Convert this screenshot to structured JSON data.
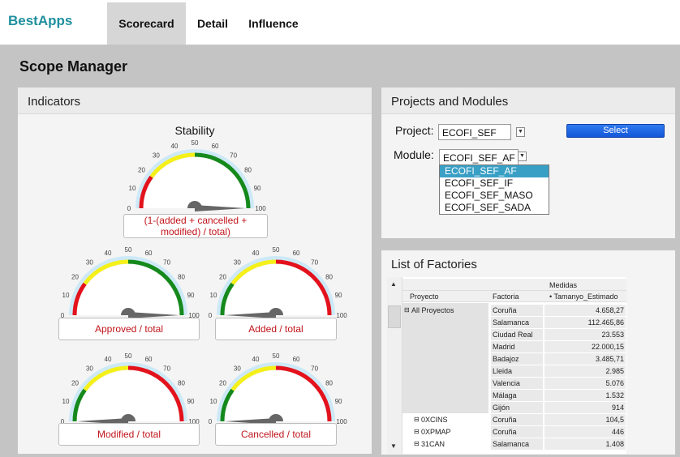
{
  "app": {
    "brand": "BestApps",
    "tabs": [
      {
        "label": "Scorecard"
      },
      {
        "label": "Detail"
      },
      {
        "label": "Influence"
      }
    ],
    "page_title": "Scope Manager"
  },
  "indicators": {
    "title": "Indicators",
    "gauges": [
      {
        "title": "Stability",
        "label": "(1-(added + cancelled + modified) / total)",
        "value": 100,
        "zones": "red-yellow-green"
      },
      {
        "title": "",
        "label": "Approved / total",
        "value": 100,
        "zones": "red-yellow-green"
      },
      {
        "title": "",
        "label": "Added / total",
        "value": 0,
        "zones": "green-yellow-red"
      },
      {
        "title": "",
        "label": "Modified / total",
        "value": 0,
        "zones": "green-yellow-red"
      },
      {
        "title": "",
        "label": "Cancelled / total",
        "value": 0,
        "zones": "green-yellow-red"
      }
    ],
    "ticks": [
      "0",
      "10",
      "20",
      "30",
      "40",
      "50",
      "60",
      "70",
      "80",
      "90",
      "100"
    ],
    "colors": {
      "red": "#e3121c",
      "yellow": "#f5f019",
      "green": "#15891c",
      "halo": "#cde9f7",
      "needle": "#666666"
    }
  },
  "projects": {
    "title": "Projects and Modules",
    "project_label": "Project:",
    "project_value": "ECOFI_SEF",
    "select_button": "Select",
    "module_label": "Module:",
    "module_value": "ECOFI_SEF_AF",
    "module_options": [
      "ECOFI_SEF_AF",
      "ECOFI_SEF_IF",
      "ECOFI_SEF_MASO",
      "ECOFI_SEF_SADA"
    ],
    "button_color": "#1e63e0"
  },
  "factories": {
    "title": "List of Factories",
    "medidas": "Medidas",
    "col_proyecto": "Proyecto",
    "col_factoria": "Factoria",
    "col_measure": "Tamanyo_Estimado",
    "group_all": "All Proyectos",
    "rows": [
      {
        "proyecto": "All Proyectos",
        "factoria": "Coruña",
        "value": "4.658,27"
      },
      {
        "proyecto": "",
        "factoria": "Salamanca",
        "value": "112.465,86"
      },
      {
        "proyecto": "",
        "factoria": "Ciudad Real",
        "value": "23.553"
      },
      {
        "proyecto": "",
        "factoria": "Madrid",
        "value": "22.000,15"
      },
      {
        "proyecto": "",
        "factoria": "Badajoz",
        "value": "3.485,71"
      },
      {
        "proyecto": "",
        "factoria": "Lleida",
        "value": "2.985"
      },
      {
        "proyecto": "",
        "factoria": "Valencia",
        "value": "5.076"
      },
      {
        "proyecto": "",
        "factoria": "Málaga",
        "value": "1.532"
      },
      {
        "proyecto": "",
        "factoria": "Gijón",
        "value": "914"
      },
      {
        "proyecto": "0XCINS",
        "factoria": "Coruña",
        "value": "104,5"
      },
      {
        "proyecto": "0XPMAP",
        "factoria": "Coruña",
        "value": "446"
      },
      {
        "proyecto": "31CAN",
        "factoria": "Salamanca",
        "value": "1.408"
      }
    ]
  }
}
